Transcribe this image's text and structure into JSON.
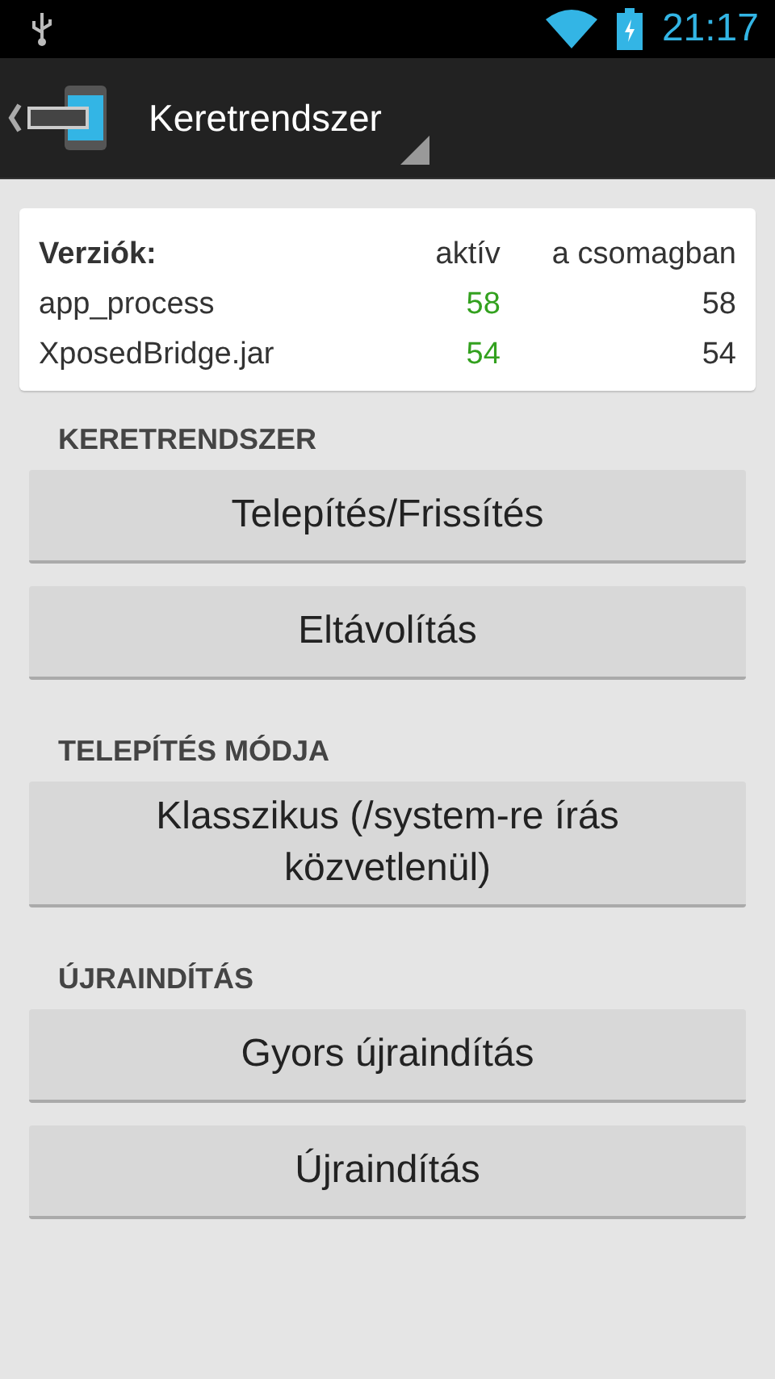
{
  "status_bar": {
    "time": "21:17"
  },
  "action_bar": {
    "title": "Keretrendszer"
  },
  "versions": {
    "heading": "Verziók:",
    "column_active": "aktív",
    "column_package": "a csomagban",
    "rows": [
      {
        "name": "app_process",
        "active": "58",
        "package": "58",
        "color": "#33a11f"
      },
      {
        "name": "XposedBridge.jar",
        "active": "54",
        "package": "54",
        "color": "#33a11f"
      }
    ]
  },
  "sections": [
    {
      "title": "KERETRENDSZER",
      "buttons": [
        "Telepítés/Frissítés",
        "Eltávolítás"
      ]
    },
    {
      "title": "TELEPÍTÉS MÓDJA",
      "buttons": [
        "Klasszikus (/system-re írás közvetlenül)"
      ]
    },
    {
      "title": "ÚJRAINDÍTÁS",
      "buttons": [
        "Gyors újraindítás",
        "Újraindítás"
      ]
    }
  ]
}
